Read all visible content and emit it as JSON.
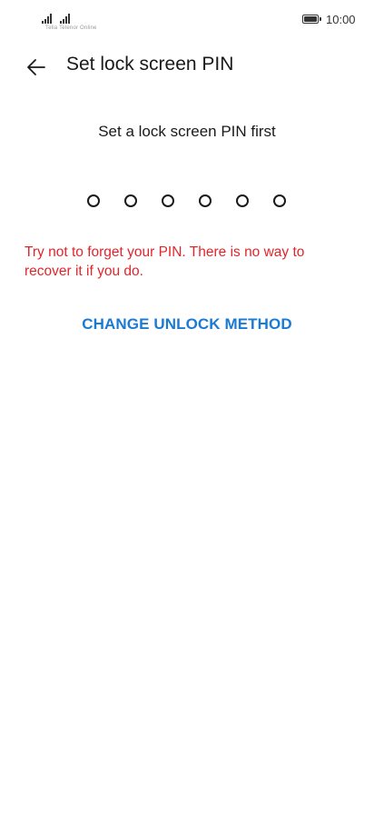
{
  "status_bar": {
    "time": "10:00",
    "carrier": "Telia Telenor Online",
    "icons": [
      "signal-icon",
      "signal-icon",
      "battery-icon"
    ]
  },
  "header": {
    "title": "Set lock screen PIN",
    "back_icon": "arrow-left-icon"
  },
  "main": {
    "prompt": "Set a lock screen PIN first",
    "pin_length": 6,
    "pin_entered": 0,
    "warning": "Try not to forget your PIN. There is no way to recover it if you do.",
    "change_method_label": "CHANGE UNLOCK METHOD"
  },
  "colors": {
    "warning": "#e0262c",
    "accent": "#1a7ad4",
    "text": "#1a1a1a"
  }
}
